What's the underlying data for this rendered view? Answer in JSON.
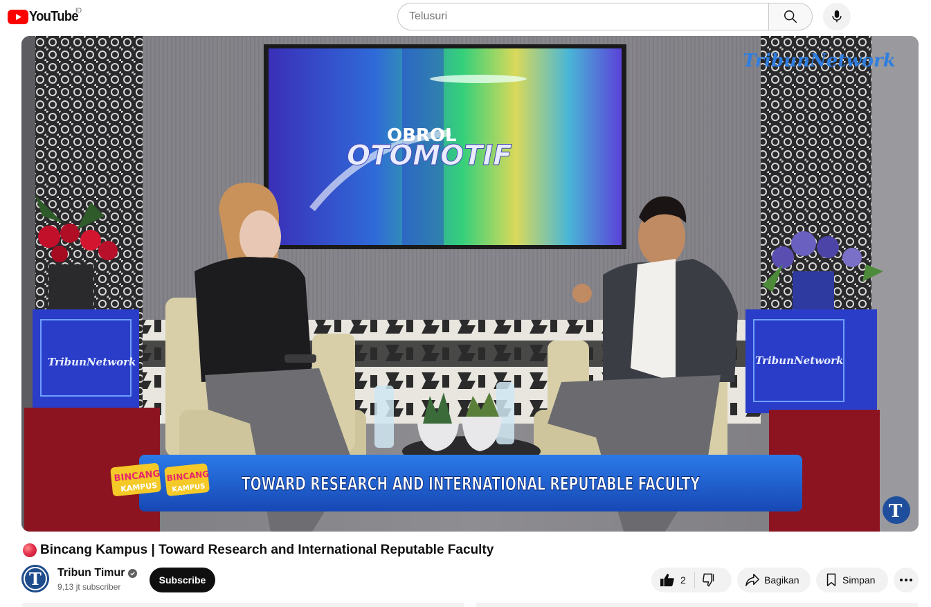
{
  "header": {
    "logo_text": "YouTube",
    "country_code": "ID",
    "search_placeholder": "Telusuri",
    "search_icon": "search-icon",
    "mic_icon": "microphone-icon"
  },
  "video": {
    "screen_text_line1": "OBROL",
    "screen_text_line2": "OTOMOTIF",
    "watermark": "TribunNetwork",
    "box_label_left": "TribunNetwork",
    "box_label_right": "TribunNetwork",
    "lower_third_badge": "BINCANG",
    "lower_third_badge_sub": "KAMPUS",
    "lower_third_text": "TOWARD RESEARCH AND INTERNATIONAL REPUTABLE FACULTY",
    "corner_logo": "T"
  },
  "title": {
    "text": "Bincang Kampus | Toward Research and International Reputable Faculty",
    "live_icon": "live-dot-icon"
  },
  "channel": {
    "name": "Tribun Timur",
    "subscribers": "9,13 jt subscriber",
    "subscribe_label": "Subscribe",
    "avatar_letter": "T"
  },
  "actions": {
    "like_count": "2",
    "share_label": "Bagikan",
    "save_label": "Simpan"
  },
  "colors": {
    "youtube_red": "#ff0000",
    "lower_third_blue": "#1b5fd0",
    "channel_blue": "#1e4c8c"
  }
}
